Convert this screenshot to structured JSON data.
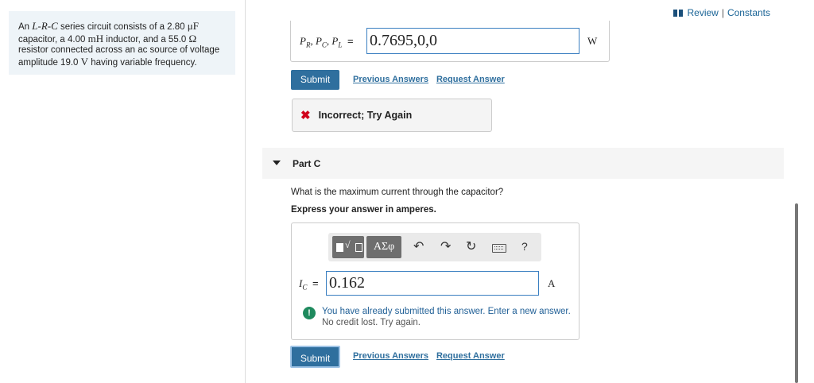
{
  "header": {
    "review_label": "Review",
    "separator": "|",
    "constants_label": "Constants"
  },
  "problem": {
    "part1": "An ",
    "circuit": "L-R-C",
    "part2": " series circuit consists of a 2.80 ",
    "cap_unit": "μF",
    "part3": " capacitor, a 4.00 ",
    "ind_unit": "mH",
    "part4": " inductor, and a 55.0 ",
    "res_unit": "Ω",
    "part5": " resistor connected across an ac source of voltage amplitude 19.0 ",
    "volt_unit": "V",
    "part6": " having variable frequency."
  },
  "partB": {
    "label": "P",
    "label_sub": "R",
    "label_rest1": ", P",
    "label_sub2": "C",
    "label_rest2": ", P",
    "label_sub3": "L",
    "eq": " =",
    "value": "0.7695,0,0",
    "unit": "W",
    "submit": "Submit",
    "previous_answers": "Previous Answers",
    "request_answer": "Request Answer",
    "feedback_icon": "✖",
    "feedback": "Incorrect; Try Again"
  },
  "partC": {
    "title": "Part C",
    "question": "What is the maximum current through the capacitor?",
    "express": "Express your answer in amperes.",
    "toolbar": {
      "greek": "ΑΣφ",
      "help": "?",
      "undo_icon": "undo-icon",
      "redo_icon": "redo-icon",
      "reset_icon": "reset-icon",
      "keyboard_icon": "keyboard-icon"
    },
    "label": "I",
    "label_sub": "C",
    "eq": " =",
    "value": "0.162",
    "unit": "A",
    "warning_icon": "!",
    "warning_line1": "You have already submitted this answer. Enter a new answer.",
    "warning_line2": "No credit lost. Try again.",
    "submit": "Submit",
    "previous_answers": "Previous Answers",
    "request_answer": "Request Answer"
  },
  "colors": {
    "accent": "#2f6f9e",
    "error": "#d0021b",
    "warning": "#1f8a5e"
  }
}
